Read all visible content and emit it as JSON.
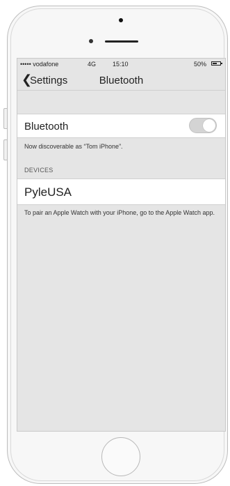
{
  "status_bar": {
    "carrier": "••••• vodafone",
    "network": "4G",
    "time": "15:10",
    "battery": "50%"
  },
  "nav": {
    "back_label": "Settings",
    "title": "Bluetooth"
  },
  "bluetooth_row": {
    "label": "Bluetooth",
    "toggle_on": false
  },
  "discoverable_text": "Now discoverable as “Tom iPhone”.",
  "devices": {
    "header": "DEVICES",
    "items": [
      {
        "name": "PyleUSA"
      }
    ]
  },
  "watch_hint": "To pair an Apple Watch with your iPhone, go to the Apple Watch app."
}
